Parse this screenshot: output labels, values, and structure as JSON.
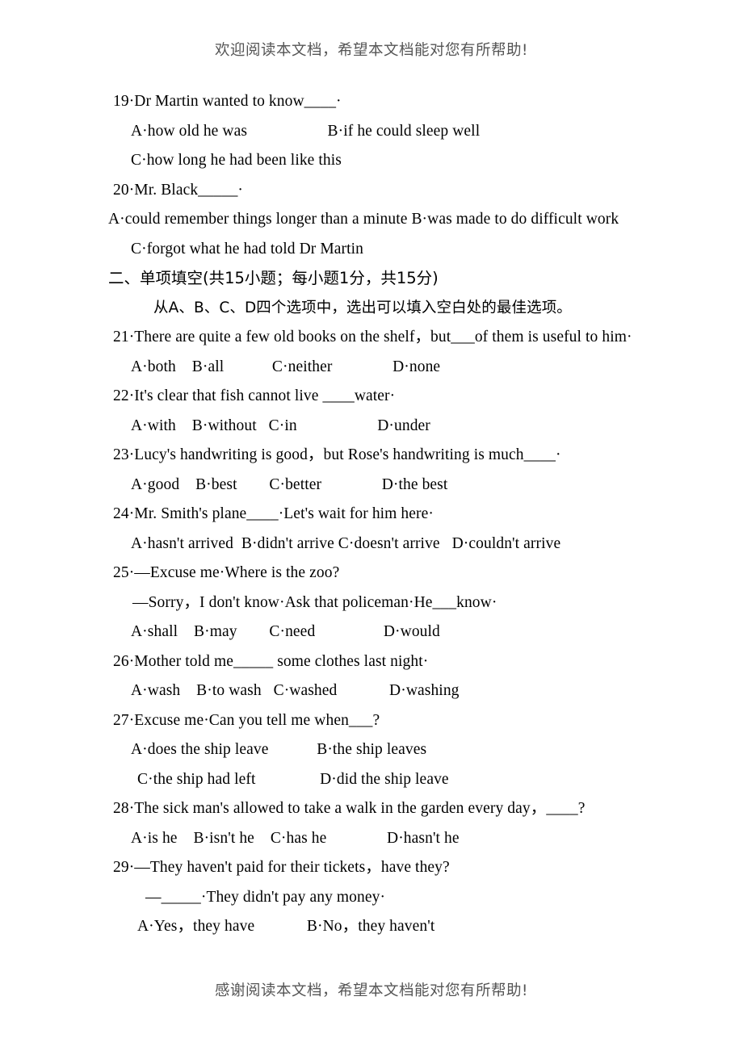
{
  "document": {
    "header_note": "欢迎阅读本文档，希望本文档能对您有所帮助!",
    "footer_note": "感谢阅读本文档，希望本文档能对您有所帮助!"
  },
  "content": {
    "q19_stem": "19·Dr Martin wanted to know____·",
    "q19_opt_ab": "A·how old he was                    B·if he could sleep well",
    "q19_opt_c": "C·how long he had been like this",
    "q20_stem": "20·Mr. Black_____·",
    "q20_opt_ab": "A·could remember things longer than a minute  B·was made to do difficult work",
    "q20_opt_c": "C·forgot what he had told Dr Martin",
    "section_title": "二、单项填空(共15小题；每小题1分，共15分)",
    "section_instruction": "从A、B、C、D四个选项中，选出可以填入空白处的最佳选项。",
    "q21_stem": "21·There are quite a few old books on the shelf，but___of them is useful to him·",
    "q21_opts": "A·both    B·all            C·neither               D·none",
    "q22_stem": "22·It's clear that fish cannot live ____water·",
    "q22_opts": "A·with    B·without   C·in                    D·under",
    "q23_stem": "23·Lucy's handwriting is good，but Rose's handwriting is much____·",
    "q23_opts": "A·good    B·best        C·better               D·the best",
    "q24_stem": "24·Mr. Smith's plane____·Let's wait for him here·",
    "q24_opts": "A·hasn't arrived  B·didn't arrive C·doesn't arrive   D·couldn't arrive",
    "q25_stem": "25·—Excuse me·Where is the zoo?",
    "q25_reply": "—Sorry，I don't know·Ask that policeman·He___know·",
    "q25_opts": "A·shall    B·may        C·need                 D·would",
    "q26_stem": "26·Mother told me_____ some clothes last night·",
    "q26_opts": "A·wash    B·to wash   C·washed             D·washing",
    "q27_stem": "27·Excuse me·Can you tell me when___?",
    "q27_opt_ab": "A·does the ship leave            B·the ship leaves",
    "q27_opt_cd": "C·the ship had left                D·did the ship leave",
    "q28_stem": "28·The sick man's allowed to take a walk in the garden every day，____?",
    "q28_opts": "A·is he    B·isn't he    C·has he               D·hasn't he",
    "q29_stem": "29·—They haven't paid for their tickets，have they?",
    "q29_reply": "—_____·They didn't pay any money·",
    "q29_opts": "A·Yes，they have             B·No，they haven't"
  }
}
